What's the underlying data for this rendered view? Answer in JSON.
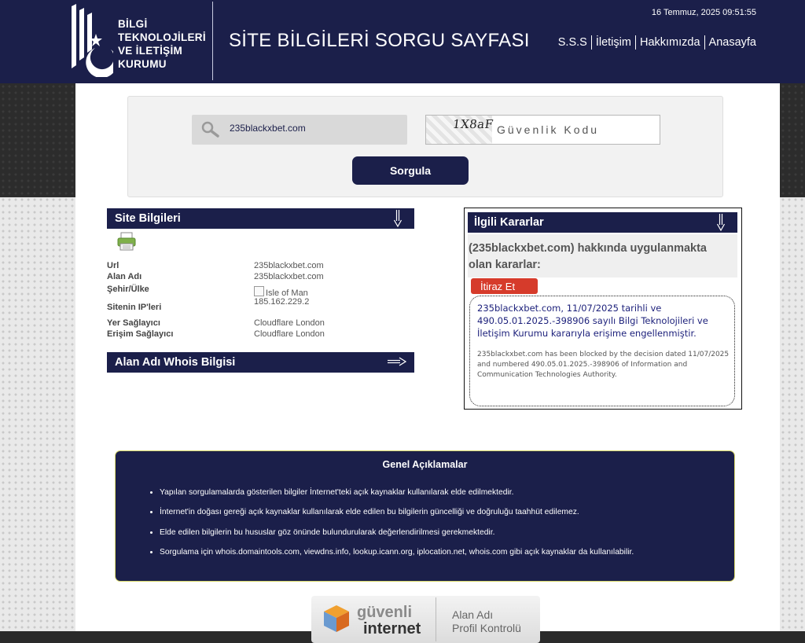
{
  "header": {
    "logo_lines": [
      "BİLGİ",
      "TEKNOLOJİLERİ",
      "VE İLETİŞİM",
      "KURUMU"
    ],
    "page_title": "SİTE BİLGİLERİ SORGU SAYFASI",
    "datetime": "16 Temmuz, 2025 09:51:55",
    "nav": [
      "S.S.S",
      "İletişim",
      "Hakkımızda",
      "Anasayfa"
    ]
  },
  "search": {
    "domain_value": "235blackxbet.com",
    "captcha_text": "1X8aF",
    "captcha_placeholder": "Güvenlik Kodu",
    "submit_label": "Sorgula"
  },
  "site_info": {
    "title": "Site Bilgileri",
    "rows": [
      {
        "key": "Url",
        "value": "235blackxbet.com"
      },
      {
        "key": "Alan Adı",
        "value": "235blackxbet.com"
      },
      {
        "key": "Şehir/Ülke",
        "value": "Isle of Man"
      },
      {
        "key": "Sitenin IP'leri",
        "value": "185.162.229.2"
      },
      {
        "key": "Yer Sağlayıcı",
        "value": "Cloudflare London"
      },
      {
        "key": "Erişim Sağlayıcı",
        "value": "Cloudflare London"
      }
    ],
    "whois_title": "Alan Adı Whois Bilgisi"
  },
  "decisions": {
    "title": "İlgili Kararlar",
    "heading": "(235blackxbet.com) hakkında uygulanmakta olan kararlar:",
    "objection_label": "İtiraz Et",
    "text_tr": "235blackxbet.com, 11/07/2025 tarihli ve 490.05.01.2025.-398906 sayılı Bilgi Teknolojileri ve İletişim Kurumu kararıyla erişime engellenmiştir.",
    "text_en": "235blackxbet.com has been blocked by the decision dated 11/07/2025 and numbered 490.05.01.2025.-398906 of Information and Communication Technologies Authority."
  },
  "general": {
    "title": "Genel Açıklamalar",
    "items": [
      "Yapılan sorgulamalarda gösterilen bilgiler İnternet'teki açık kaynaklar kullanılarak elde edilmektedir.",
      "İnternet'in doğası gereği açık kaynaklar kullanılarak elde edilen bu bilgilerin güncelliği ve doğruluğu taahhüt edilemez.",
      "Elde edilen bilgilerin bu hususlar göz önünde bulundurularak değerlendirilmesi gerekmektedir.",
      "Sorgulama için whois.domaintools.com, viewdns.info, lookup.icann.org, iplocation.net, whois.com gibi açık kaynaklar da kullanılabilir."
    ]
  },
  "badge": {
    "line1": "güvenli",
    "line2": "internet",
    "line3": "Alan Adı",
    "line4": "Profil Kontrolü"
  },
  "colors": {
    "navy": "#1b1f4a",
    "objection_red": "#d63b2b",
    "decision_text": "#1b1f7a"
  }
}
